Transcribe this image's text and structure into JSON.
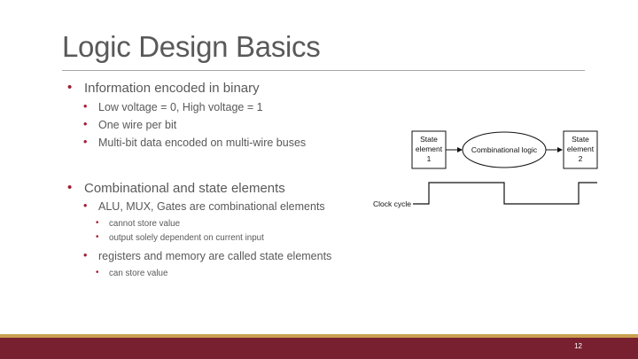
{
  "slide": {
    "title": "Logic Design Basics",
    "page_number": "12",
    "colors": {
      "title_text": "#595959",
      "bullet_marker": "#a31c33",
      "footer_bar": "#782030",
      "footer_accent": "#c9a04f"
    }
  },
  "bullets": {
    "b1": "Information encoded in binary",
    "b1_1": "Low voltage = 0, High voltage = 1",
    "b1_2": "One wire per bit",
    "b1_3": "Multi-bit data encoded on multi-wire buses",
    "b2": "Combinational and state elements",
    "b2_1": "ALU, MUX, Gates are combinational elements",
    "b2_1_1": "cannot store value",
    "b2_1_2": "output solely dependent on current input",
    "b2_2": "registers and memory are called state elements",
    "b2_2_1": "can store value"
  },
  "diagram": {
    "state1_line1": "State",
    "state1_line2": "element",
    "state1_line3": "1",
    "combinational": "Combinational logic",
    "state2_line1": "State",
    "state2_line2": "element",
    "state2_line3": "2",
    "clock_label": "Clock cycle"
  }
}
